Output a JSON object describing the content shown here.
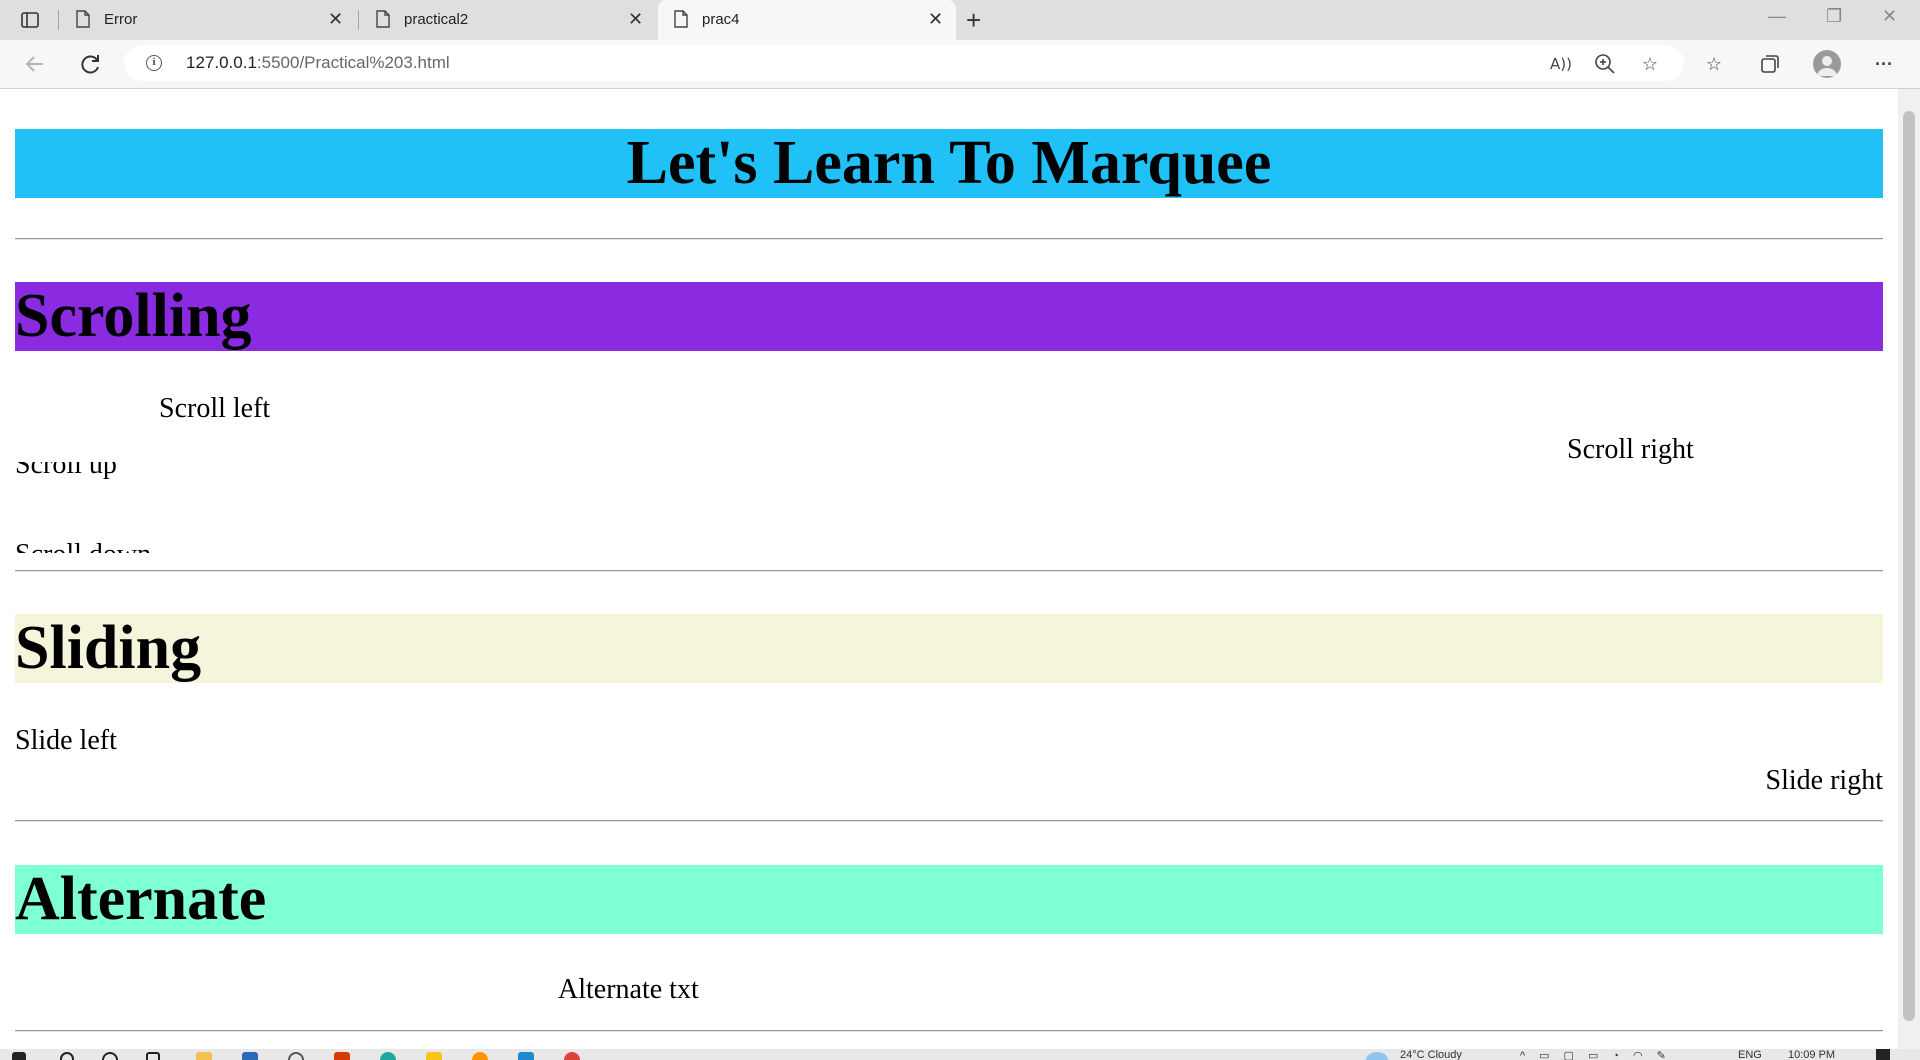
{
  "browser": {
    "tabs": [
      {
        "title": "Error"
      },
      {
        "title": "practical2"
      },
      {
        "title": "prac4"
      }
    ],
    "url_host": "127.0.0.1",
    "url_rest": ":5500/Practical%203.html"
  },
  "page": {
    "main_heading": "Let's Learn To Marquee",
    "scrolling": {
      "heading": "Scrolling",
      "scroll_left": "Scroll left",
      "scroll_right": "Scroll right",
      "scroll_up": "Scroll up",
      "scroll_down": "Scroll down"
    },
    "sliding": {
      "heading": "Sliding",
      "slide_left": "Slide left",
      "slide_right": "Slide right"
    },
    "alternate": {
      "heading": "Alternate",
      "text": "Alternate txt"
    }
  },
  "taskbar": {
    "weather": "24°C  Cloudy",
    "lang": "ENG",
    "time": "10:09 PM"
  },
  "colors": {
    "main_band": "#1fc1f7",
    "scrolling_band": "#8a2be2",
    "sliding_band": "#f5f5dc",
    "alternate_band": "#7fffd4"
  }
}
